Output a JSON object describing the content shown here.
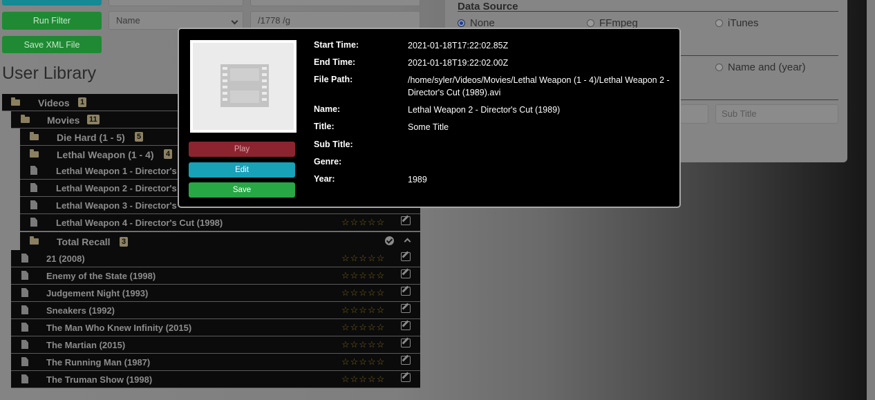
{
  "toolbar": {
    "run_filter_label": "Run Filter",
    "save_xml_label": "Save XML File",
    "filter_field": "Name",
    "filter_pattern": "/1778 /g"
  },
  "library": {
    "title": "User Library",
    "videos": {
      "label": "Videos",
      "count": "1"
    },
    "movies": {
      "label": "Movies",
      "count": "11"
    },
    "die_hard": {
      "label": "Die Hard (1 - 5)",
      "count": "5"
    },
    "lethal_weapon": {
      "label": "Lethal Weapon (1 - 4)",
      "count": "4"
    },
    "lw_items": [
      "Lethal Weapon 1 - Director's",
      "Lethal Weapon 2 - Director's",
      "Lethal Weapon 3 - Director's",
      "Lethal Weapon 4 - Director's Cut (1998)"
    ],
    "total_recall": {
      "label": "Total Recall",
      "count": "3"
    },
    "movie_items": [
      "21 (2008)",
      "Enemy of the State (1998)",
      "Judgement Night (1993)",
      "Sneakers (1992)",
      "The Man Who Knew Infinity (2015)",
      "The Martian (2015)",
      "The Running Man (1987)",
      "The Truman Show (1998)"
    ],
    "stars": "☆☆☆☆☆"
  },
  "data_source": {
    "heading": "Data Source",
    "options": [
      "None",
      "FFmpeg",
      "iTunes"
    ],
    "selected": "None",
    "name_option": "Name and (year)",
    "sub_title_placeholder": "Sub Title"
  },
  "modal": {
    "play_label": "Play",
    "edit_label": "Edit",
    "save_label": "Save",
    "details": {
      "start_time_label": "Start Time:",
      "start_time": "2021-01-18T17:22:02.85Z",
      "end_time_label": "End Time:",
      "end_time": "2021-01-18T19:22:02.00Z",
      "file_path_label": "File Path:",
      "file_path": "/home/syler/Videos/Movies/Lethal Weapon (1 - 4)/Lethal Weapon 2 - Director's Cut (1989).avi",
      "name_label": "Name:",
      "name": "Lethal Weapon 2 - Director's Cut (1989)",
      "title_label": "Title:",
      "title": "Some Title",
      "sub_title_label": "Sub Title:",
      "sub_title": "",
      "genre_label": "Genre:",
      "genre": "",
      "year_label": "Year:",
      "year": "1989"
    }
  }
}
